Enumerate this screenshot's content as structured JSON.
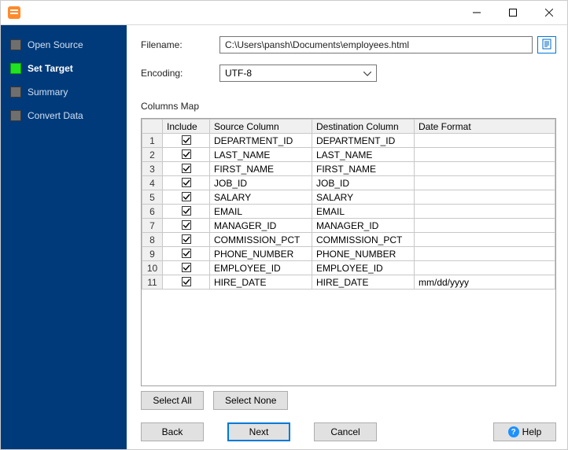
{
  "titlebar": {
    "title": ""
  },
  "sidebar": {
    "items": [
      {
        "label": "Open Source",
        "active": false
      },
      {
        "label": "Set Target",
        "active": true
      },
      {
        "label": "Summary",
        "active": false
      },
      {
        "label": "Convert Data",
        "active": false
      }
    ]
  },
  "form": {
    "filename_label": "Filename:",
    "filename_value": "C:\\Users\\pansh\\Documents\\employees.html",
    "encoding_label": "Encoding:",
    "encoding_value": "UTF-8",
    "columns_map_label": "Columns Map"
  },
  "table": {
    "headers": {
      "rownum": "",
      "include": "Include",
      "source": "Source Column",
      "destination": "Destination Column",
      "date_format": "Date Format"
    },
    "rows": [
      {
        "n": "1",
        "include": true,
        "source": "DEPARTMENT_ID",
        "destination": "DEPARTMENT_ID",
        "date_format": ""
      },
      {
        "n": "2",
        "include": true,
        "source": "LAST_NAME",
        "destination": "LAST_NAME",
        "date_format": ""
      },
      {
        "n": "3",
        "include": true,
        "source": "FIRST_NAME",
        "destination": "FIRST_NAME",
        "date_format": ""
      },
      {
        "n": "4",
        "include": true,
        "source": "JOB_ID",
        "destination": "JOB_ID",
        "date_format": ""
      },
      {
        "n": "5",
        "include": true,
        "source": "SALARY",
        "destination": "SALARY",
        "date_format": ""
      },
      {
        "n": "6",
        "include": true,
        "source": "EMAIL",
        "destination": "EMAIL",
        "date_format": ""
      },
      {
        "n": "7",
        "include": true,
        "source": "MANAGER_ID",
        "destination": "MANAGER_ID",
        "date_format": ""
      },
      {
        "n": "8",
        "include": true,
        "source": "COMMISSION_PCT",
        "destination": "COMMISSION_PCT",
        "date_format": ""
      },
      {
        "n": "9",
        "include": true,
        "source": "PHONE_NUMBER",
        "destination": "PHONE_NUMBER",
        "date_format": ""
      },
      {
        "n": "10",
        "include": true,
        "source": "EMPLOYEE_ID",
        "destination": "EMPLOYEE_ID",
        "date_format": ""
      },
      {
        "n": "11",
        "include": true,
        "source": "HIRE_DATE",
        "destination": "HIRE_DATE",
        "date_format": "mm/dd/yyyy"
      }
    ]
  },
  "buttons": {
    "select_all": "Select All",
    "select_none": "Select None",
    "back": "Back",
    "next": "Next",
    "cancel": "Cancel",
    "help": "Help"
  }
}
